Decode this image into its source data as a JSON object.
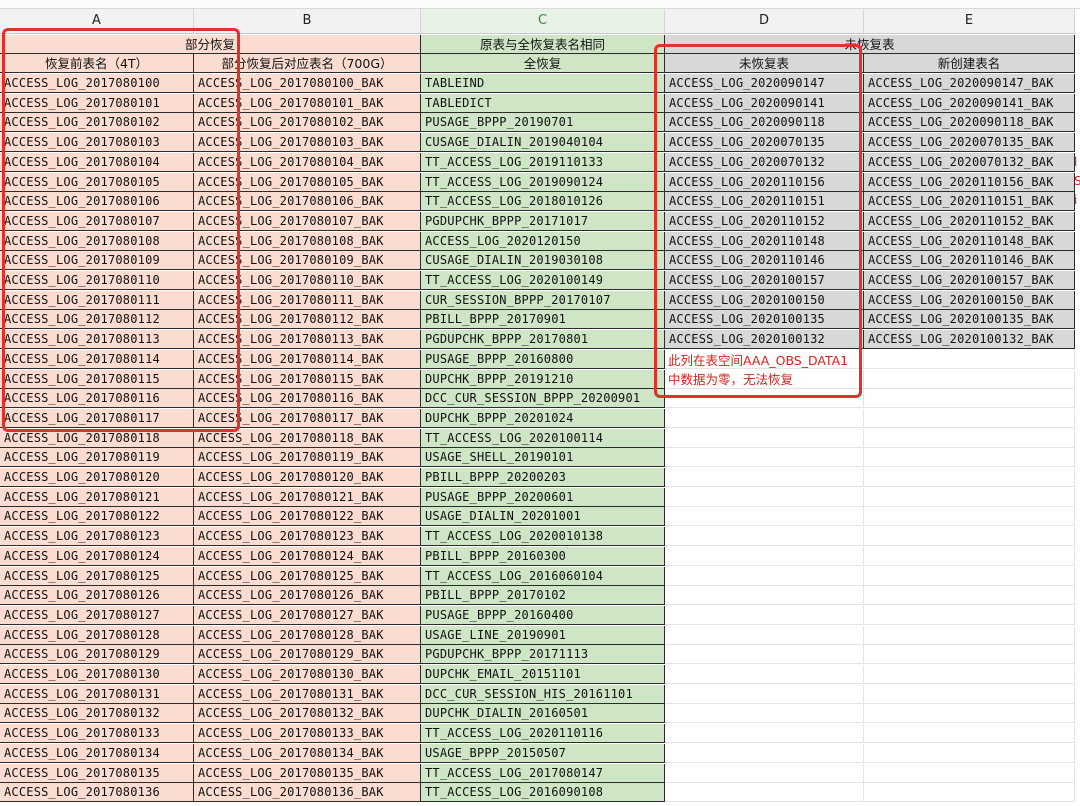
{
  "columns": [
    "A",
    "B",
    "C",
    "D",
    "E"
  ],
  "group_headers": {
    "ab": "部分恢复",
    "c": "原表与全恢复表名相同",
    "de": "未恢复表"
  },
  "sub_headers": {
    "a": "恢复前表名（4T）",
    "b": "部分恢复后对应表名（700G）",
    "c": "全恢复",
    "d": "未恢复表",
    "e": "新创建表名"
  },
  "col_a": [
    "ACCESS_LOG_2017080100",
    "ACCESS_LOG_2017080101",
    "ACCESS_LOG_2017080102",
    "ACCESS_LOG_2017080103",
    "ACCESS_LOG_2017080104",
    "ACCESS_LOG_2017080105",
    "ACCESS_LOG_2017080106",
    "ACCESS_LOG_2017080107",
    "ACCESS_LOG_2017080108",
    "ACCESS_LOG_2017080109",
    "ACCESS_LOG_2017080110",
    "ACCESS_LOG_2017080111",
    "ACCESS_LOG_2017080112",
    "ACCESS_LOG_2017080113",
    "ACCESS_LOG_2017080114",
    "ACCESS_LOG_2017080115",
    "ACCESS_LOG_2017080116",
    "ACCESS_LOG_2017080117",
    "ACCESS_LOG_2017080118",
    "ACCESS_LOG_2017080119",
    "ACCESS_LOG_2017080120",
    "ACCESS_LOG_2017080121",
    "ACCESS_LOG_2017080122",
    "ACCESS_LOG_2017080123",
    "ACCESS_LOG_2017080124",
    "ACCESS_LOG_2017080125",
    "ACCESS_LOG_2017080126",
    "ACCESS_LOG_2017080127",
    "ACCESS_LOG_2017080128",
    "ACCESS_LOG_2017080129",
    "ACCESS_LOG_2017080130",
    "ACCESS_LOG_2017080131",
    "ACCESS_LOG_2017080132",
    "ACCESS_LOG_2017080133",
    "ACCESS_LOG_2017080134",
    "ACCESS_LOG_2017080135",
    "ACCESS_LOG_2017080136"
  ],
  "col_b": [
    "ACCESS_LOG_2017080100_BAK",
    "ACCESS_LOG_2017080101_BAK",
    "ACCESS_LOG_2017080102_BAK",
    "ACCESS_LOG_2017080103_BAK",
    "ACCESS_LOG_2017080104_BAK",
    "ACCESS_LOG_2017080105_BAK",
    "ACCESS_LOG_2017080106_BAK",
    "ACCESS_LOG_2017080107_BAK",
    "ACCESS_LOG_2017080108_BAK",
    "ACCESS_LOG_2017080109_BAK",
    "ACCESS_LOG_2017080110_BAK",
    "ACCESS_LOG_2017080111_BAK",
    "ACCESS_LOG_2017080112_BAK",
    "ACCESS_LOG_2017080113_BAK",
    "ACCESS_LOG_2017080114_BAK",
    "ACCESS_LOG_2017080115_BAK",
    "ACCESS_LOG_2017080116_BAK",
    "ACCESS_LOG_2017080117_BAK",
    "ACCESS_LOG_2017080118_BAK",
    "ACCESS_LOG_2017080119_BAK",
    "ACCESS_LOG_2017080120_BAK",
    "ACCESS_LOG_2017080121_BAK",
    "ACCESS_LOG_2017080122_BAK",
    "ACCESS_LOG_2017080123_BAK",
    "ACCESS_LOG_2017080124_BAK",
    "ACCESS_LOG_2017080125_BAK",
    "ACCESS_LOG_2017080126_BAK",
    "ACCESS_LOG_2017080127_BAK",
    "ACCESS_LOG_2017080128_BAK",
    "ACCESS_LOG_2017080129_BAK",
    "ACCESS_LOG_2017080130_BAK",
    "ACCESS_LOG_2017080131_BAK",
    "ACCESS_LOG_2017080132_BAK",
    "ACCESS_LOG_2017080133_BAK",
    "ACCESS_LOG_2017080134_BAK",
    "ACCESS_LOG_2017080135_BAK",
    "ACCESS_LOG_2017080136_BAK"
  ],
  "col_c": [
    "TABLEIND",
    "TABLEDICT",
    "PUSAGE_BPPP_20190701",
    "CUSAGE_DIALIN_2019040104",
    "TT_ACCESS_LOG_2019110133",
    "TT_ACCESS_LOG_2019090124",
    "TT_ACCESS_LOG_2018010126",
    "PGDUPCHK_BPPP_20171017",
    "ACCESS_LOG_2020120150",
    "CUSAGE_DIALIN_2019030108",
    "TT_ACCESS_LOG_2020100149",
    "CUR_SESSION_BPPP_20170107",
    "PBILL_BPPP_20170901",
    "PGDUPCHK_BPPP_20170801",
    "PUSAGE_BPPP_20160800",
    "DUPCHK_BPPP_20191210",
    "DCC_CUR_SESSION_BPPP_20200901",
    "DUPCHK_BPPP_20201024",
    "TT_ACCESS_LOG_2020100114",
    "USAGE_SHELL_20190101",
    "PBILL_BPPP_20200203",
    "PUSAGE_BPPP_20200601",
    "USAGE_DIALIN_20201001",
    "TT_ACCESS_LOG_2020010138",
    "PBILL_BPPP_20160300",
    "TT_ACCESS_LOG_2016060104",
    "PBILL_BPPP_20170102",
    "PUSAGE_BPPP_20160400",
    "USAGE_LINE_20190901",
    "PGDUPCHK_BPPP_20171113",
    "DUPCHK_EMAIL_20151101",
    "DCC_CUR_SESSION_HIS_20161101",
    "DUPCHK_DIALIN_20160501",
    "TT_ACCESS_LOG_2020110116",
    "USAGE_BPPP_20150507",
    "TT_ACCESS_LOG_2017080147",
    "TT_ACCESS_LOG_2016090108"
  ],
  "col_d": [
    "ACCESS_LOG_2020090147",
    "ACCESS_LOG_2020090141",
    "ACCESS_LOG_2020090118",
    "ACCESS_LOG_2020070135",
    "ACCESS_LOG_2020070132",
    "ACCESS_LOG_2020110156",
    "ACCESS_LOG_2020110151",
    "ACCESS_LOG_2020110152",
    "ACCESS_LOG_2020110148",
    "ACCESS_LOG_2020110146",
    "ACCESS_LOG_2020100157",
    "ACCESS_LOG_2020100150",
    "ACCESS_LOG_2020100135",
    "ACCESS_LOG_2020100132"
  ],
  "col_e": [
    "ACCESS_LOG_2020090147_BAK",
    "ACCESS_LOG_2020090141_BAK",
    "ACCESS_LOG_2020090118_BAK",
    "ACCESS_LOG_2020070135_BAK",
    "ACCESS_LOG_2020070132_BAK",
    "ACCESS_LOG_2020110156_BAK",
    "ACCESS_LOG_2020110151_BAK",
    "ACCESS_LOG_2020110152_BAK",
    "ACCESS_LOG_2020110148_BAK",
    "ACCESS_LOG_2020110146_BAK",
    "ACCESS_LOG_2020100157_BAK",
    "ACCESS_LOG_2020100150_BAK",
    "ACCESS_LOG_2020100135_BAK",
    "ACCESS_LOG_2020100132_BAK"
  ],
  "note": {
    "line1": "此列在表空间AAA_OBS_DATA1",
    "line2": "中数据为零，无法恢复"
  },
  "edge_chars": [
    "l",
    "S",
    "i"
  ],
  "colors": {
    "pink": "#fbdcd0",
    "green": "#cfe6c6",
    "gray": "#d8d8d8",
    "annotation_red": "#e0322b"
  }
}
